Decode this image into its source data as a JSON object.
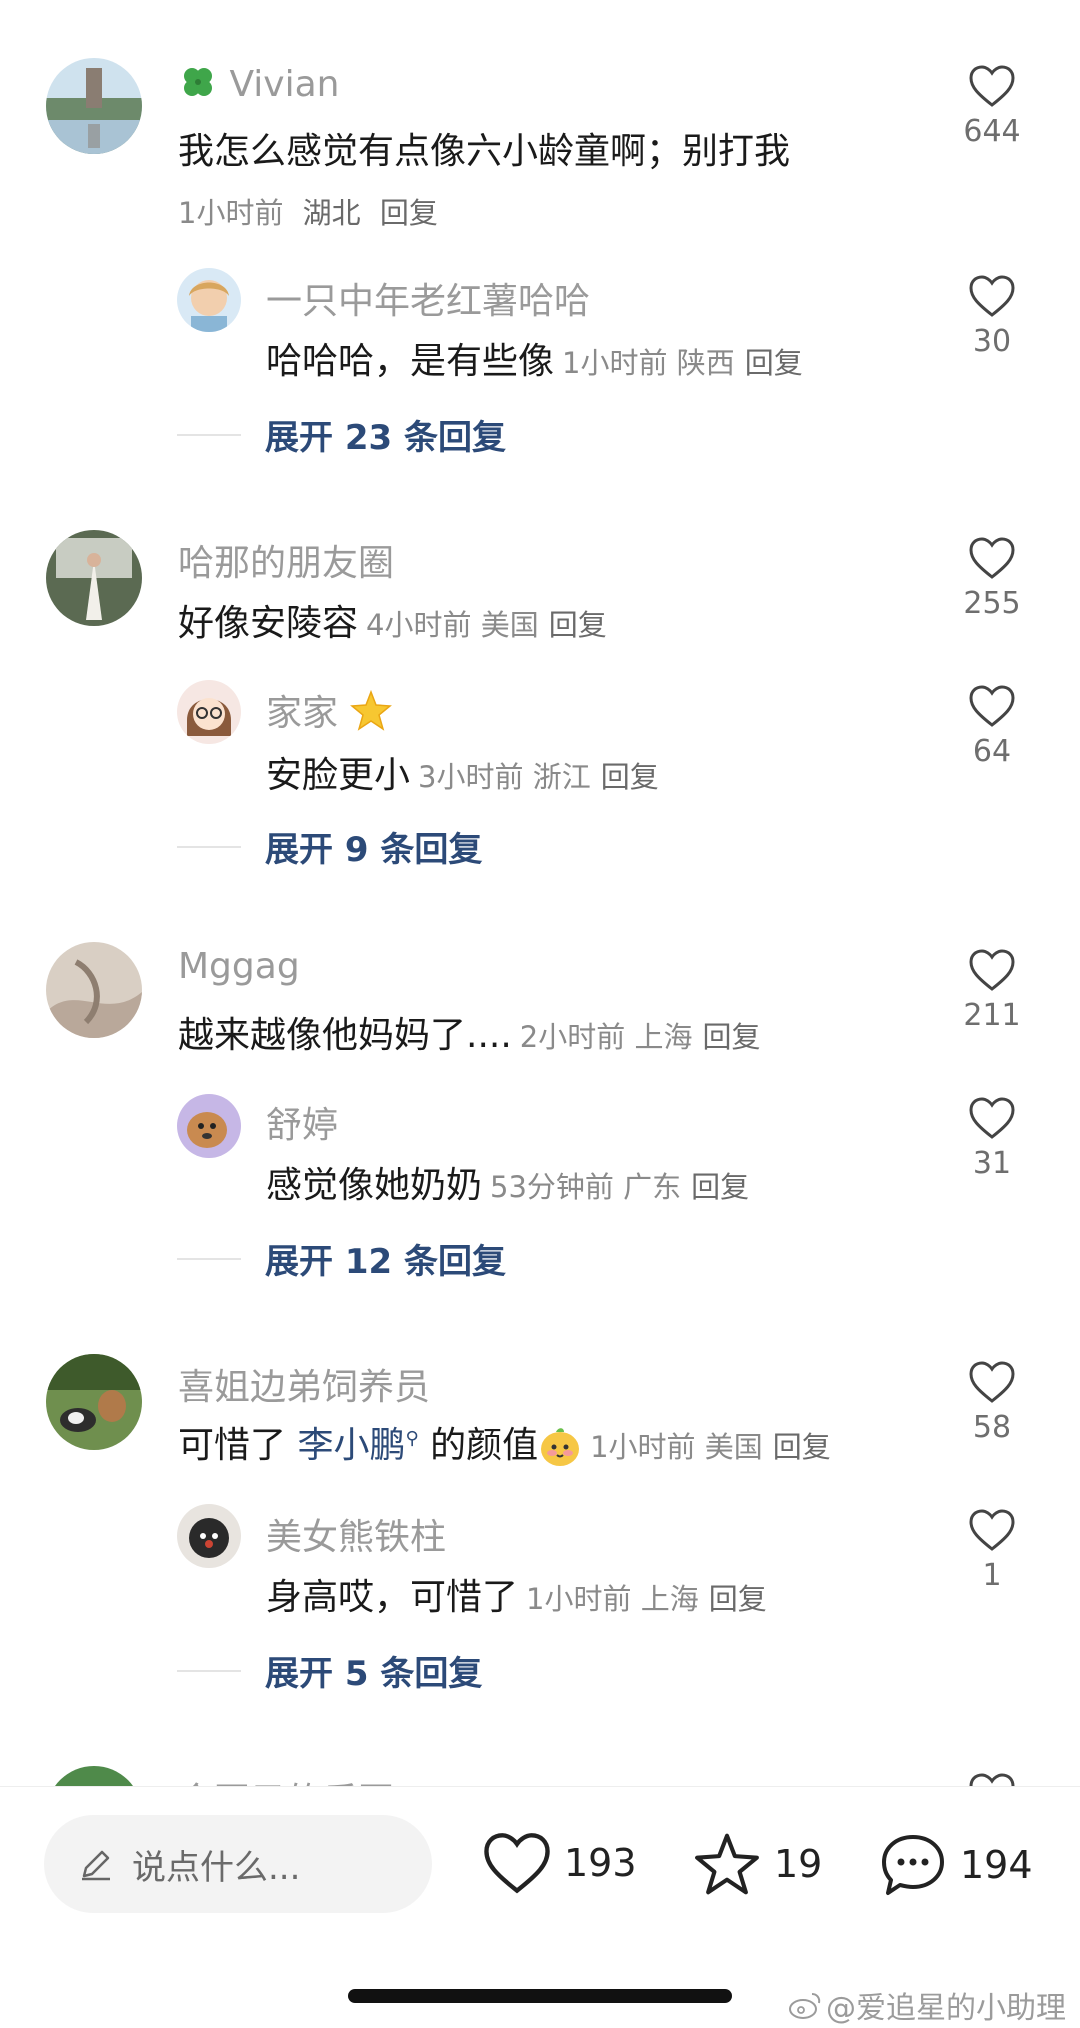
{
  "comments": [
    {
      "user": "Vivian",
      "user_prefix_icon": "four-leaf-clover",
      "text": "我怎么感觉有点像六小龄童啊；别打我",
      "time": "1小时前",
      "location": "湖北",
      "reply_label": "回复",
      "likes": "644",
      "reply": {
        "user": "一只中年老红薯哈哈",
        "text": "哈哈哈，是有些像",
        "time": "1小时前",
        "location": "陕西",
        "reply_label": "回复",
        "likes": "30"
      },
      "expand_label": "展开 23 条回复"
    },
    {
      "user": "哈那的朋友圈",
      "text": "好像安陵容",
      "time": "4小时前",
      "location": "美国",
      "reply_label": "回复",
      "likes": "255",
      "reply": {
        "user": "家家",
        "user_suffix_icon": "star",
        "text": "安脸更小",
        "time": "3小时前",
        "location": "浙江",
        "reply_label": "回复",
        "likes": "64"
      },
      "expand_label": "展开 9 条回复"
    },
    {
      "user": "Mggag",
      "text": "越来越像他妈妈了....",
      "time": "2小时前",
      "location": "上海",
      "reply_label": "回复",
      "likes": "211",
      "reply": {
        "user": "舒婷",
        "text": "感觉像她奶奶",
        "time": "53分钟前",
        "location": "广东",
        "reply_label": "回复",
        "likes": "31"
      },
      "expand_label": "展开 12 条回复"
    },
    {
      "user": "喜姐边弟饲养员",
      "text_before": "可惜了 ",
      "mention": "李小鹏",
      "text_after": " 的颜值",
      "emoji": "smiling-face-sticker",
      "time": "1小时前",
      "location": "美国",
      "reply_label": "回复",
      "likes": "58",
      "reply": {
        "user": "美女熊铁柱",
        "text": "身高哎，可惜了",
        "time": "1小时前",
        "location": "上海",
        "reply_label": "回复",
        "likes": "1"
      },
      "expand_label": "展开 5 条回复"
    },
    {
      "user": "金豆子的乐园"
    }
  ],
  "bottom_bar": {
    "input_placeholder": "说点什么...",
    "like_count": "193",
    "favorite_count": "19",
    "comment_count": "194"
  },
  "watermark": "@爱追星的小助理",
  "colors": {
    "link": "#2c4a78",
    "username": "#9a9a9a",
    "meta": "#8a8a8a"
  }
}
